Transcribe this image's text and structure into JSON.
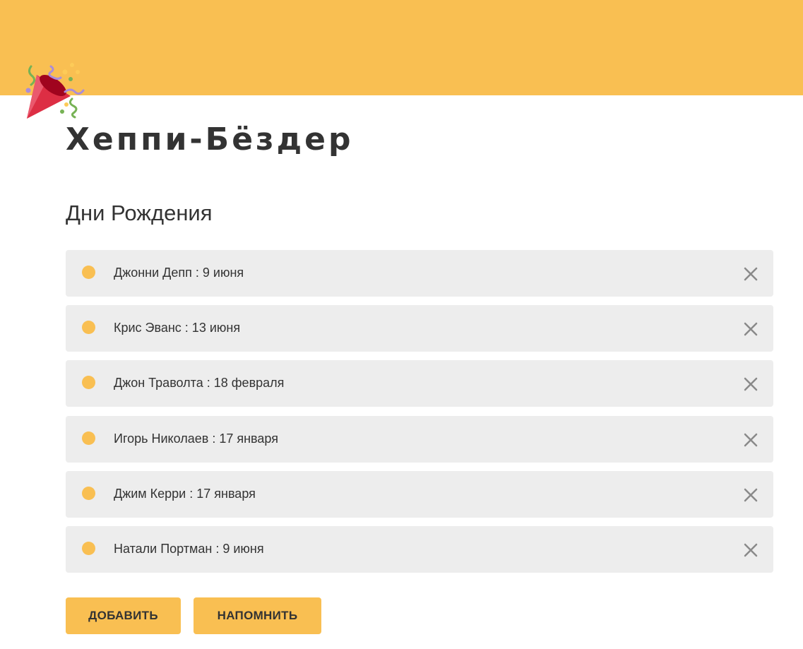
{
  "app": {
    "title": "Хеппи-Бёздер",
    "logo_icon": "party-popper-icon"
  },
  "colors": {
    "accent": "#f9bf52",
    "item_background": "#ededed",
    "text": "#333333",
    "remove_icon": "#8a8a8a"
  },
  "birthdays": {
    "heading": "Дни Рождения",
    "items": [
      {
        "label": "Джонни Депп : 9 июня"
      },
      {
        "label": "Крис Эванс : 13 июня"
      },
      {
        "label": "Джон Траволта : 18 февраля"
      },
      {
        "label": "Игорь Николаев : 17 января"
      },
      {
        "label": "Джим Керри : 17 января"
      },
      {
        "label": "Натали Портман : 9 июня"
      }
    ],
    "remove_icon": "close-icon"
  },
  "actions": {
    "add_label": "ДОБАВИТЬ",
    "remind_label": "НАПОМНИТЬ"
  }
}
